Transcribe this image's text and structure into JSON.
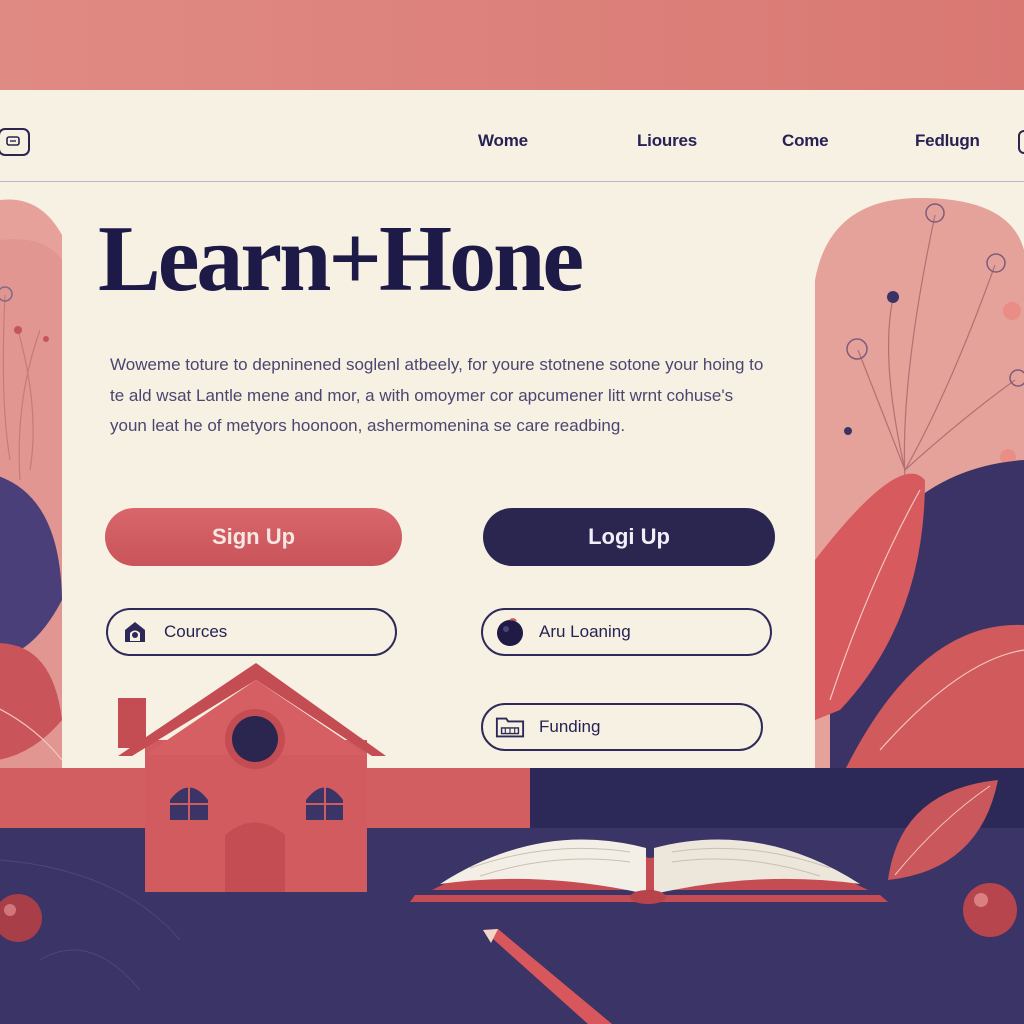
{
  "header": {
    "nav": [
      "Wome",
      "Lioures",
      "Come",
      "Fedlugn"
    ]
  },
  "hero": {
    "title": "Learn+Hone",
    "intro": "Woweme toture to depninened soglenl atbeely, for youre stotnene sotone your hoing to te ald wsat Lantle mene and mor, a with omoymer cor apcumener litt wrnt cohuse's youn leat he of metyors hoonoon, ashermomenina se care readbing."
  },
  "actions": {
    "signup_label": "Sign Up",
    "login_label": "Logi Up"
  },
  "links": [
    {
      "label": "Cources",
      "icon": "house-badge-icon"
    },
    {
      "label": "Aru Loaning",
      "icon": "apple-icon"
    },
    {
      "label": "Funding",
      "icon": "folder-icon"
    }
  ],
  "colors": {
    "band": "#d97873",
    "panel": "#f7f1e3",
    "ink": "#1d1a48",
    "accent": "#d8666b",
    "navy": "#2b2650"
  }
}
